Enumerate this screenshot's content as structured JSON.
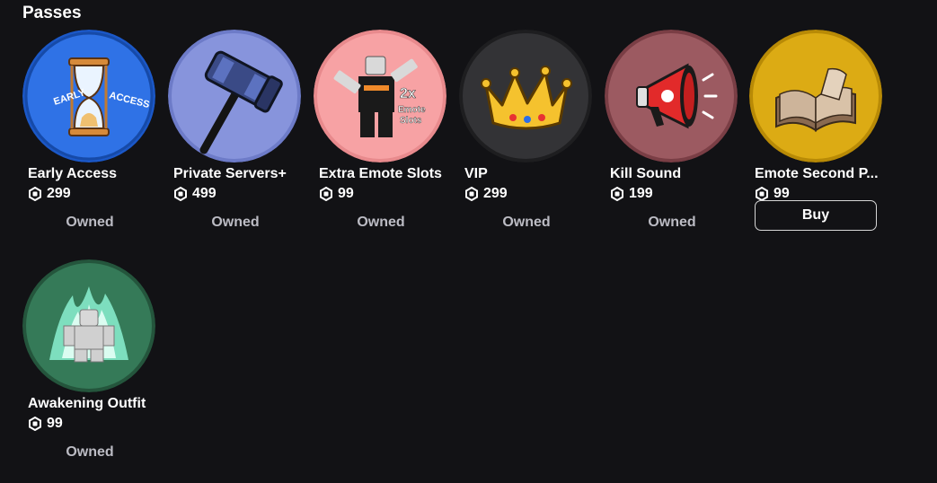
{
  "section_title": "Passes",
  "currency_icon": "robux-icon",
  "passes": [
    {
      "name": "Early Access",
      "price": "299",
      "status": "Owned",
      "icon": "hourglass-icon",
      "bg": "#2f6fe0",
      "label_left": "EARLY",
      "label_right": "ACCESS"
    },
    {
      "name": "Private Servers+",
      "price": "499",
      "status": "Owned",
      "icon": "hammer-icon",
      "bg": "#7f8cd6"
    },
    {
      "name": "Extra Emote Slots",
      "price": "99",
      "status": "Owned",
      "icon": "avatar-emote-icon",
      "bg": "#f4989a",
      "badge_line1": "2x",
      "badge_line2": "Emote",
      "badge_line3": "Slots"
    },
    {
      "name": "VIP",
      "price": "299",
      "status": "Owned",
      "icon": "crown-icon",
      "bg": "#2e2e31"
    },
    {
      "name": "Kill Sound",
      "price": "199",
      "status": "Owned",
      "icon": "megaphone-icon",
      "bg": "#8e5258"
    },
    {
      "name": "Emote Second P...",
      "price": "99",
      "status": "",
      "buy_label": "Buy",
      "icon": "book-icon",
      "bg": "#d4a20e"
    },
    {
      "name": "Awakening Outfit",
      "price": "99",
      "status": "Owned",
      "icon": "aura-avatar-icon",
      "bg": "#2f6a4d"
    }
  ]
}
